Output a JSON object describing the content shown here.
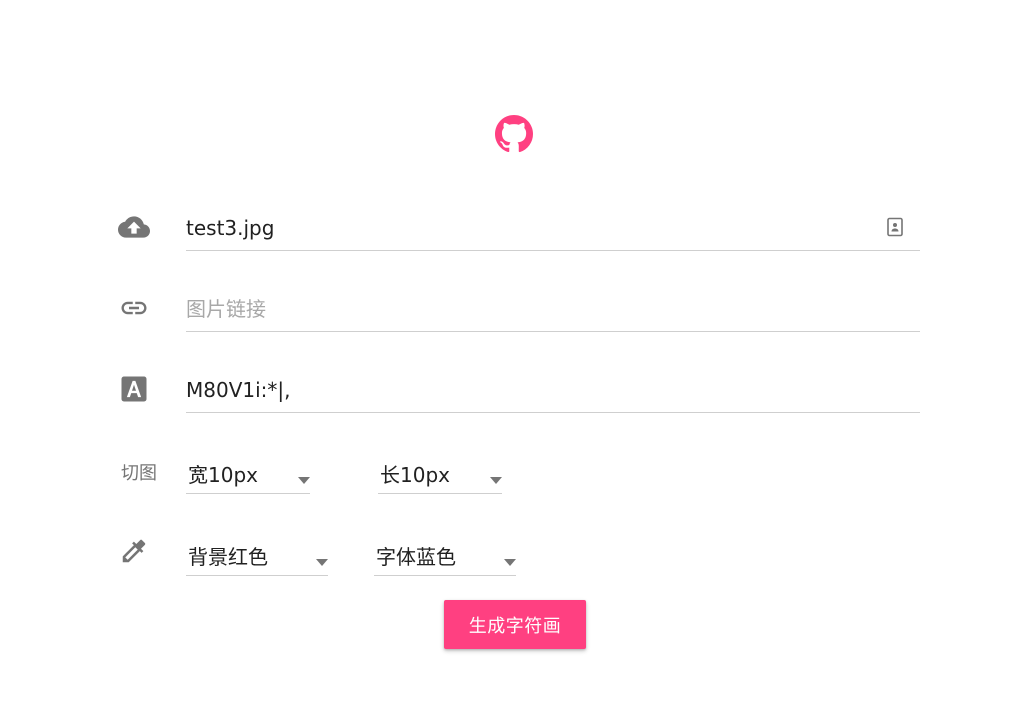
{
  "theme": {
    "accent": "#ff4081",
    "icon_color": "#757575",
    "divider": "#cfcfcf"
  },
  "header": {
    "logo_icon": "github-icon"
  },
  "upload_row": {
    "icon": "cloud-upload-icon",
    "value": "test3.jpg",
    "end_icon": "file-browse-icon"
  },
  "link_row": {
    "icon": "link-icon",
    "value": "",
    "placeholder": "图片链接"
  },
  "chars_row": {
    "icon": "text-format-icon",
    "value": "M80V1i:*|,"
  },
  "cut_row": {
    "label": "切图",
    "width_select": {
      "value": "宽10px"
    },
    "height_select": {
      "value": "长10px"
    }
  },
  "color_row": {
    "icon": "color-picker-icon",
    "background_select": {
      "value": "背景红色"
    },
    "font_select": {
      "value": "字体蓝色"
    }
  },
  "action": {
    "generate_label": "生成字符画"
  }
}
